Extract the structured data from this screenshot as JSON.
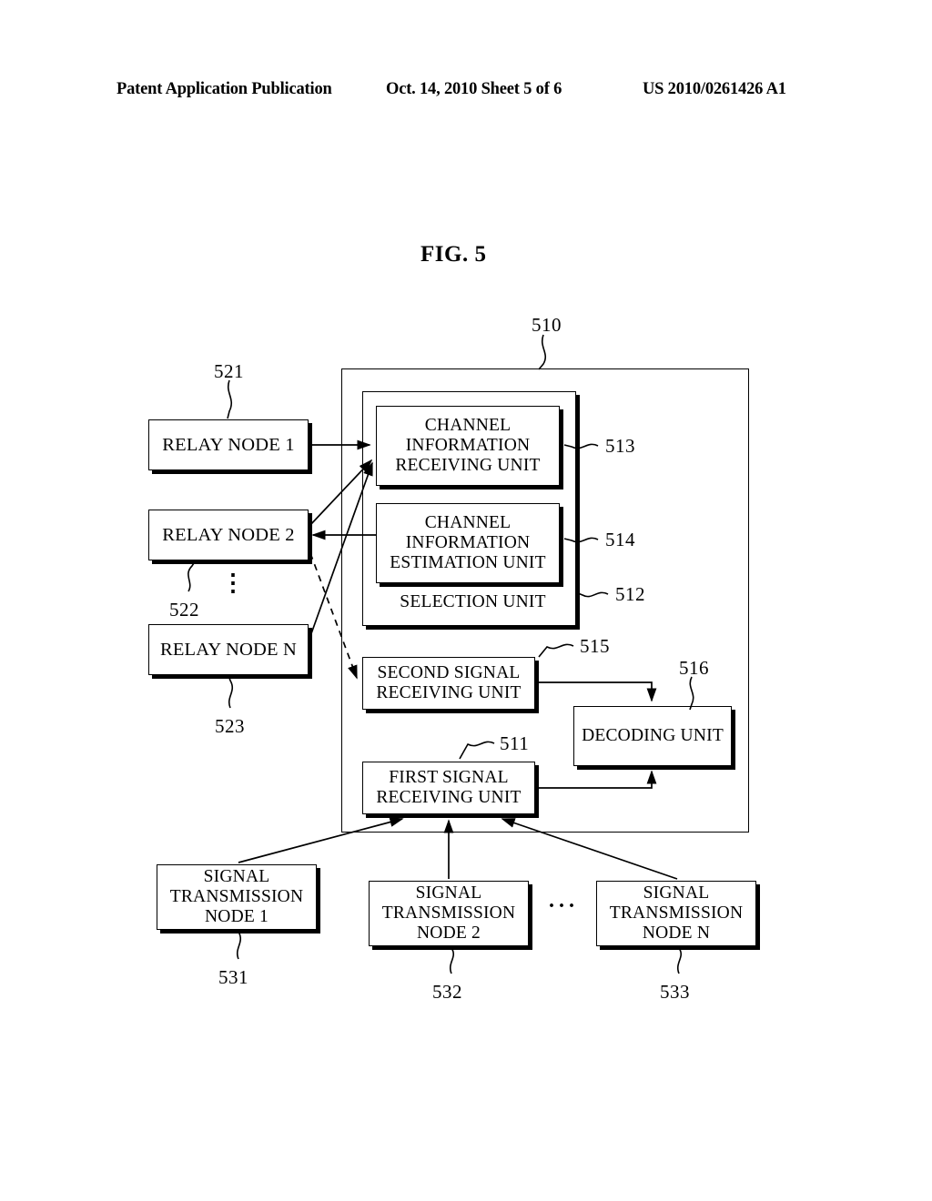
{
  "header": {
    "publication": "Patent Application Publication",
    "date_sheet": "Oct. 14, 2010  Sheet 5 of 6",
    "patent_number": "US 2010/0261426 A1"
  },
  "figure": {
    "title": "FIG. 5"
  },
  "diagram": {
    "outer_unit": {
      "ref": "510"
    },
    "selection_unit": {
      "label": "SELECTION UNIT",
      "ref": "512"
    },
    "blocks": [
      {
        "id": "relay-node-1",
        "label": "RELAY NODE 1",
        "ref": "521"
      },
      {
        "id": "relay-node-2",
        "label": "RELAY NODE 2",
        "ref": "522"
      },
      {
        "id": "relay-node-n",
        "label": "RELAY NODE N",
        "ref": "523"
      },
      {
        "id": "channel-info-recv",
        "label": "CHANNEL INFORMATION RECEIVING UNIT",
        "ref": "513"
      },
      {
        "id": "channel-info-est",
        "label": "CHANNEL INFORMATION ESTIMATION UNIT",
        "ref": "514"
      },
      {
        "id": "second-signal-recv",
        "label": "SECOND SIGNAL RECEIVING UNIT",
        "ref": "515"
      },
      {
        "id": "first-signal-recv",
        "label": "FIRST SIGNAL RECEIVING UNIT",
        "ref": "511"
      },
      {
        "id": "decoding-unit",
        "label": "DECODING UNIT",
        "ref": "516"
      },
      {
        "id": "tx-node-1",
        "label": "SIGNAL TRANSMISSION NODE 1",
        "ref": "531"
      },
      {
        "id": "tx-node-2",
        "label": "SIGNAL TRANSMISSION NODE 2",
        "ref": "532"
      },
      {
        "id": "tx-node-n",
        "label": "SIGNAL TRANSMISSION NODE N",
        "ref": "533"
      }
    ],
    "ellipsis_vertical": "⋮",
    "ellipsis_horizontal": "···"
  }
}
